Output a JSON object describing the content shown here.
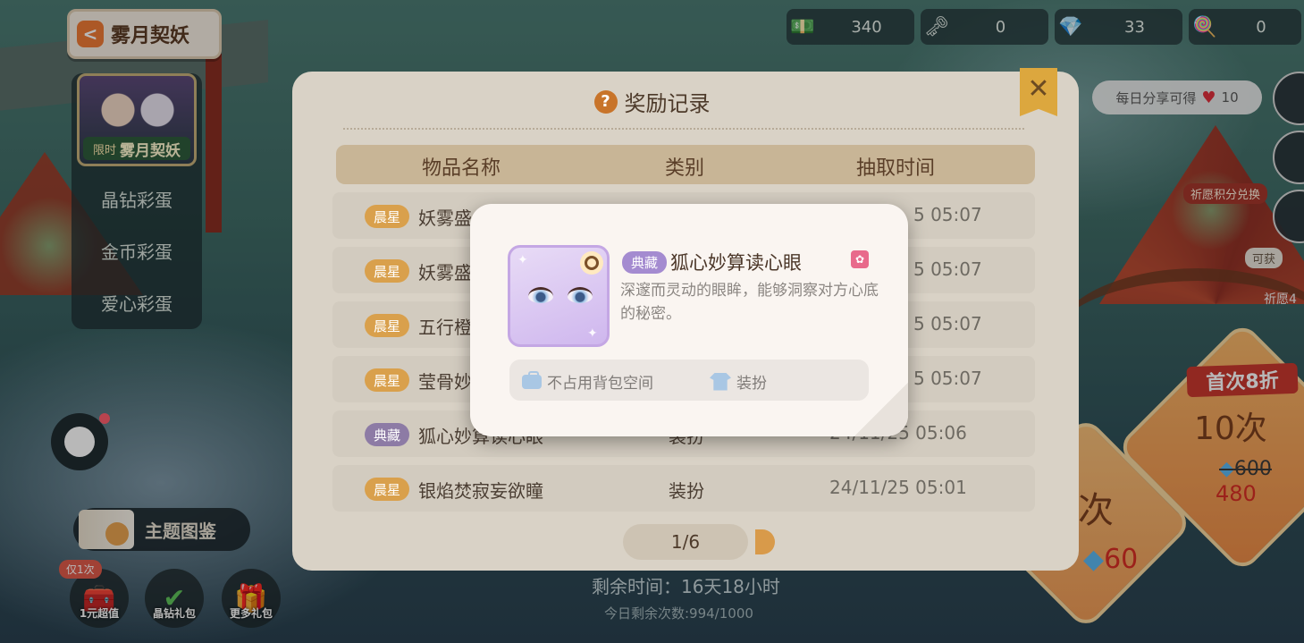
{
  "header": {
    "back_label": "雾月契妖"
  },
  "resources": [
    {
      "icon": "banknote-icon",
      "value": "340"
    },
    {
      "icon": "key-icon",
      "value": "0"
    },
    {
      "icon": "crystal-icon",
      "value": "33"
    },
    {
      "icon": "wand-icon",
      "value": "0"
    }
  ],
  "left_menu": {
    "banner_limited": "限时",
    "banner_title": "雾月契妖",
    "items": [
      "晶钻彩蛋",
      "金币彩蛋",
      "爱心彩蛋"
    ]
  },
  "theme_album": "主题图鉴",
  "bottom_buttons": [
    {
      "badge": "仅1次",
      "label": "1元超值"
    },
    {
      "label": "晶钻礼包"
    },
    {
      "label": "更多礼包"
    }
  ],
  "right": {
    "share_text": "每日分享可得",
    "share_reward": "10",
    "wish_exchange": "祈愿积分兑换",
    "obtainable": "可获",
    "wish_label": "祈愿4",
    "ten_discount": "首次8折",
    "ten_label": "10次",
    "ten_old_price": "600",
    "ten_new_price": "480",
    "one_label": "次",
    "one_price": "60"
  },
  "footer": {
    "remaining_time": "剩余时间：16天18小时",
    "remaining_count": "今日剩余次数:994/1000"
  },
  "reward_panel": {
    "title": "奖励记录",
    "columns": [
      "物品名称",
      "类别",
      "抽取时间"
    ],
    "rows": [
      {
        "tag": "晨星",
        "name": "妖雾盛",
        "category": "",
        "time": "5 05:07"
      },
      {
        "tag": "晨星",
        "name": "妖雾盛",
        "category": "",
        "time": "5 05:07"
      },
      {
        "tag": "晨星",
        "name": "五行橙",
        "category": "",
        "time": "5 05:07"
      },
      {
        "tag": "晨星",
        "name": "莹骨妙",
        "category": "",
        "time": "5 05:07"
      },
      {
        "tag": "典藏",
        "name": "狐心妙算读心眼",
        "category": "装扮",
        "time": "24/11/25 05:06"
      },
      {
        "tag": "晨星",
        "name": "银焰焚寂妄欲瞳",
        "category": "装扮",
        "time": "24/11/25 05:01"
      }
    ],
    "page": "1/6"
  },
  "item_popup": {
    "tag": "典藏",
    "name": "狐心妙算读心眼",
    "description": "深邃而灵动的眼眸，能够洞察对方心底的秘密。",
    "attr_space": "不占用背包空间",
    "attr_type": "装扮"
  },
  "colors": {
    "dawn_tag": "#d9a04c",
    "collection_tag": "#8d7ba5",
    "accent_orange": "#ef7a35",
    "price_red": "#d82e25"
  }
}
